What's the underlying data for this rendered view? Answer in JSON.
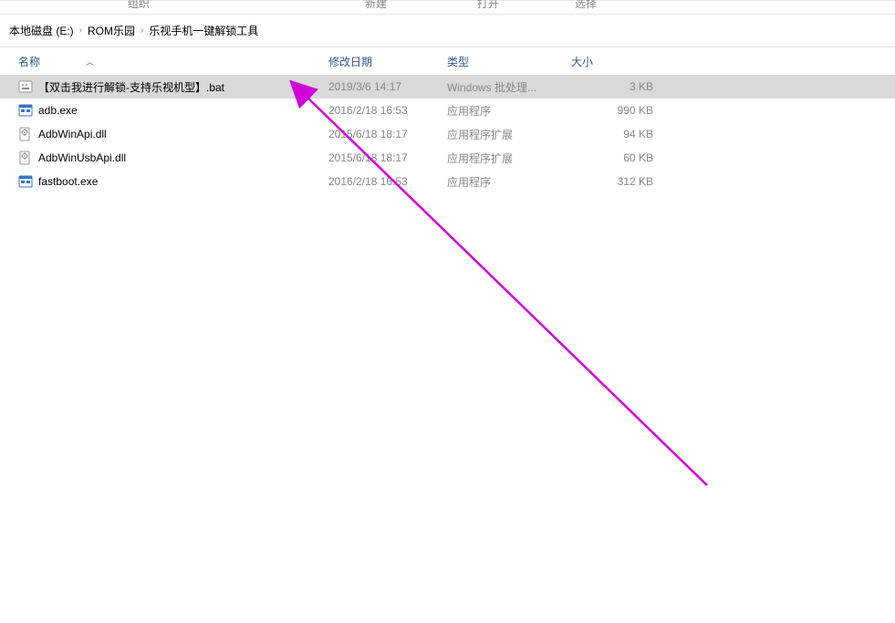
{
  "top_menu": {
    "item1": "组织",
    "item2": "新建",
    "item3": "打开",
    "item4": "选择"
  },
  "breadcrumb": {
    "seg1": "本地磁盘 (E:)",
    "seg2": "ROM乐园",
    "seg3": "乐视手机一键解锁工具"
  },
  "columns": {
    "name": "名称",
    "date": "修改日期",
    "type": "类型",
    "size": "大小"
  },
  "files": [
    {
      "name": "【双击我进行解锁-支持乐视机型】.bat",
      "date": "2019/3/6 14:17",
      "type": "Windows 批处理...",
      "size": "3 KB",
      "icon": "bat",
      "selected": true
    },
    {
      "name": "adb.exe",
      "date": "2016/2/18 16:53",
      "type": "应用程序",
      "size": "990 KB",
      "icon": "exe",
      "selected": false
    },
    {
      "name": "AdbWinApi.dll",
      "date": "2015/6/18 18:17",
      "type": "应用程序扩展",
      "size": "94 KB",
      "icon": "dll",
      "selected": false
    },
    {
      "name": "AdbWinUsbApi.dll",
      "date": "2015/6/18 18:17",
      "type": "应用程序扩展",
      "size": "60 KB",
      "icon": "dll",
      "selected": false
    },
    {
      "name": "fastboot.exe",
      "date": "2016/2/18 16:53",
      "type": "应用程序",
      "size": "312 KB",
      "icon": "exe",
      "selected": false
    }
  ]
}
